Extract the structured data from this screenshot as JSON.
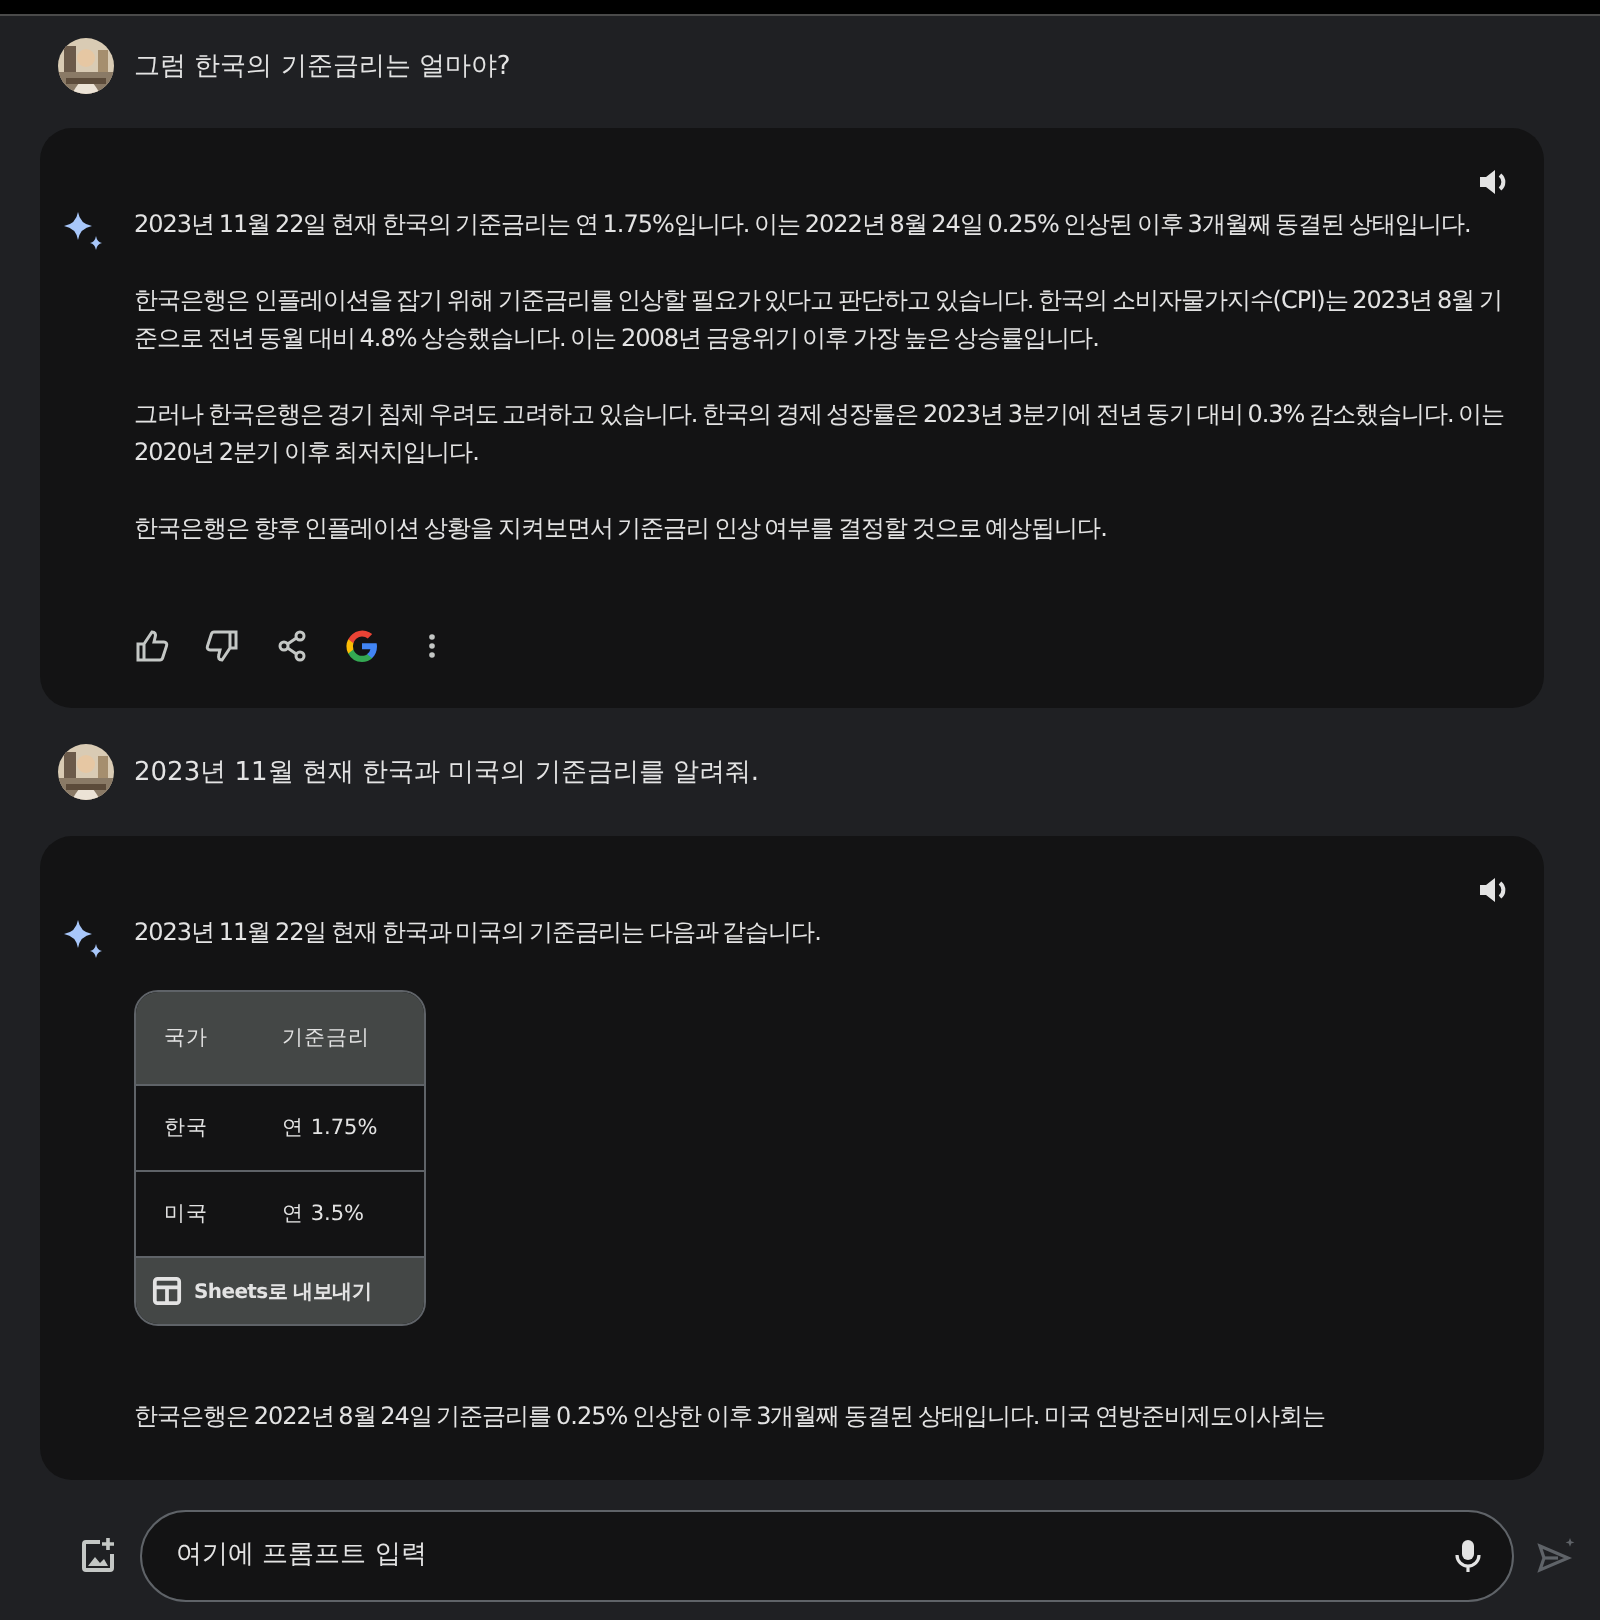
{
  "conversation": [
    {
      "kind": "user",
      "text": "그럼 한국의 기준금리는 얼마야?"
    },
    {
      "kind": "response",
      "blocks": [
        {
          "kind": "paragraph",
          "text": "2023년 11월 22일 현재 한국의 기준금리는 연 1.75%입니다. 이는 2022년 8월 24일 0.25% 인상된 이후 3개월째 동결된 상태입니다."
        },
        {
          "kind": "paragraph",
          "text": "한국은행은 인플레이션을 잡기 위해 기준금리를 인상할 필요가 있다고 판단하고 있습니다. 한국의 소비자물가지수(CPI)는 2023년 8월 기준으로 전년 동월 대비 4.8% 상승했습니다. 이는 2008년 금융위기 이후 가장 높은 상승률입니다."
        },
        {
          "kind": "paragraph",
          "text": "그러나 한국은행은 경기 침체 우려도 고려하고 있습니다. 한국의 경제 성장률은 2023년 3분기에 전년 동기 대비 0.3% 감소했습니다. 이는 2020년 2분기 이후 최저치입니다."
        },
        {
          "kind": "paragraph",
          "text": "한국은행은 향후 인플레이션 상황을 지켜보면서 기준금리 인상 여부를 결정할 것으로 예상됩니다."
        },
        {
          "kind": "actions"
        }
      ]
    },
    {
      "kind": "user",
      "text": "2023년 11월 현재 한국과 미국의 기준금리를 알려줘."
    },
    {
      "kind": "response",
      "blocks": [
        {
          "kind": "paragraph",
          "text": "2023년 11월 22일 현재 한국과 미국의 기준금리는 다음과 같습니다."
        },
        {
          "kind": "table",
          "columns": [
            "국가",
            "기준금리"
          ],
          "rows": [
            [
              "한국",
              "연 1.75%"
            ],
            [
              "미국",
              "연 3.5%"
            ]
          ],
          "export_label": "Sheets로 내보내기"
        },
        {
          "kind": "paragraph",
          "text": "한국은행은 2022년 8월 24일 기준금리를 0.25% 인상한 이후 3개월째 동결된 상태입니다. 미국 연방준비제도이사회는"
        }
      ]
    }
  ],
  "input": {
    "placeholder": "여기에 프롬프트 입력"
  }
}
